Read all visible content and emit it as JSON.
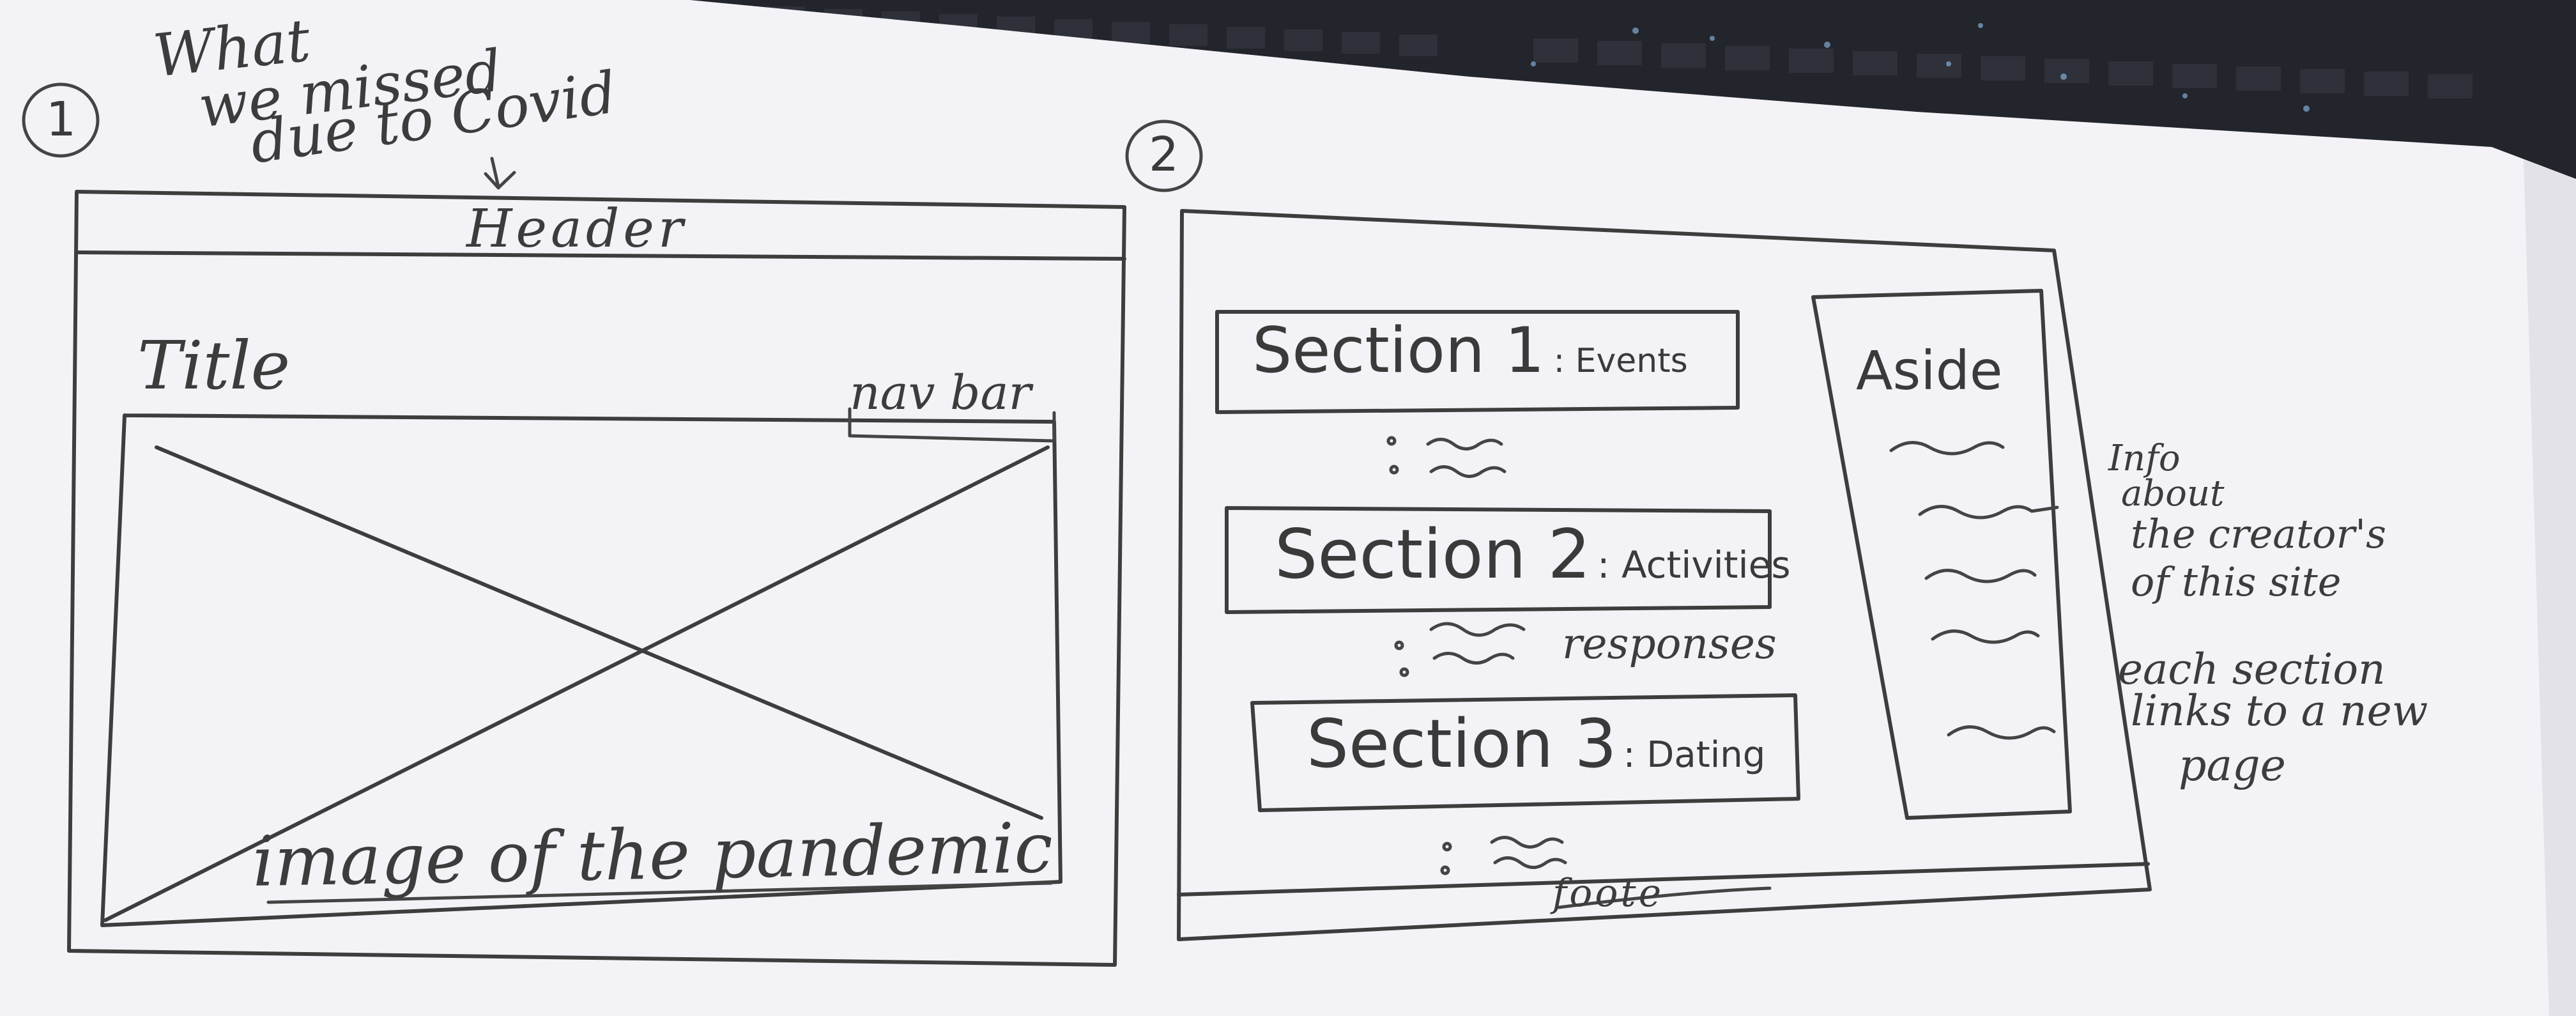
{
  "sketch1": {
    "number": "1",
    "annotation": [
      "What",
      "we missed",
      "due to Covid"
    ],
    "header_label": "Header",
    "title_label": "Title",
    "nav_label": "nav bar",
    "image_caption": "image of the pandemic"
  },
  "sketch2": {
    "number": "2",
    "sections": [
      {
        "name": "Section 1",
        "topic": ": Events"
      },
      {
        "name": "Section 2",
        "topic": ": Activities"
      },
      {
        "name": "Section 3",
        "topic": ": Dating"
      }
    ],
    "responses_label": "responses",
    "aside_label": "Aside",
    "footer_label": "foote",
    "notes": [
      "Info",
      "about",
      "the creator's",
      "of this site",
      "each section",
      "links to a new",
      "page"
    ]
  }
}
